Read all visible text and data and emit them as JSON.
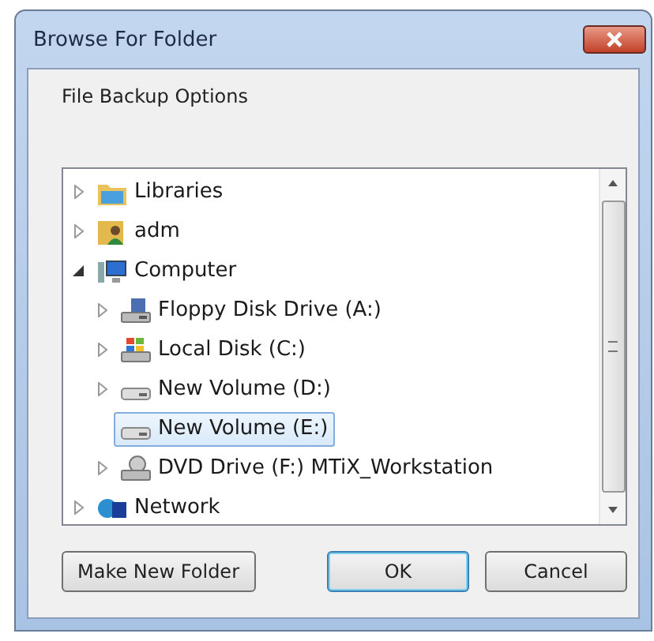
{
  "window": {
    "title": "Browse For Folder"
  },
  "description": "File Backup Options",
  "tree": [
    {
      "label": "Libraries",
      "kind": "library",
      "expandable": true,
      "expanded": false,
      "selected": false
    },
    {
      "label": "adm",
      "kind": "user",
      "expandable": true,
      "expanded": false,
      "selected": false
    },
    {
      "label": "Computer",
      "kind": "computer",
      "expandable": true,
      "expanded": true,
      "selected": false,
      "children": [
        {
          "label": "Floppy Disk Drive (A:)",
          "kind": "floppy",
          "expandable": true,
          "expanded": false,
          "selected": false
        },
        {
          "label": "Local Disk (C:)",
          "kind": "system-disk",
          "expandable": true,
          "expanded": false,
          "selected": false
        },
        {
          "label": "New Volume (D:)",
          "kind": "disk",
          "expandable": true,
          "expanded": false,
          "selected": false
        },
        {
          "label": "New Volume (E:)",
          "kind": "disk",
          "selected": true
        },
        {
          "label": "DVD Drive (F:) MTiX_Workstation",
          "kind": "dvd",
          "expandable": true,
          "expanded": false,
          "selected": false
        }
      ]
    },
    {
      "label": "Network",
      "kind": "network",
      "expandable": true,
      "expanded": false,
      "selected": false
    }
  ],
  "buttons": [
    {
      "label": "Make New Folder",
      "default": false
    },
    {
      "label": "OK",
      "default": true
    },
    {
      "label": "Cancel",
      "default": false
    }
  ]
}
